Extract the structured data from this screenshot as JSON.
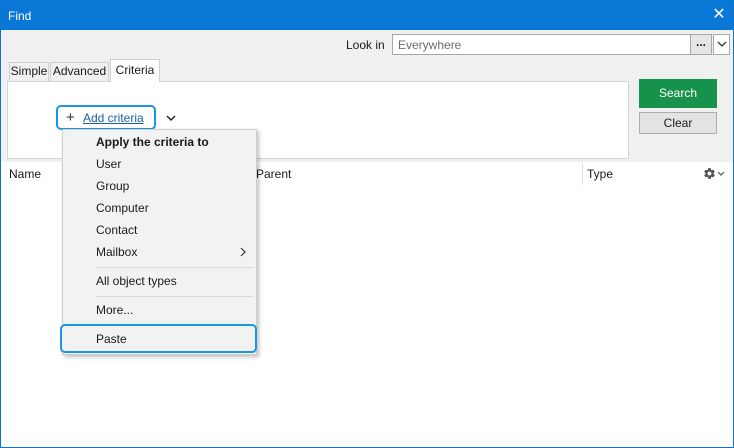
{
  "window": {
    "title": "Find"
  },
  "look_in": {
    "label": "Look in",
    "value": "Everywhere",
    "browse_label": "..."
  },
  "tabs": [
    {
      "label": "Simple",
      "active": false
    },
    {
      "label": "Advanced",
      "active": false
    },
    {
      "label": "Criteria",
      "active": true
    }
  ],
  "criteria": {
    "add_label": "Add criteria"
  },
  "buttons": {
    "search": "Search",
    "clear": "Clear"
  },
  "columns": [
    "Name",
    "Parent",
    "Type"
  ],
  "menu": {
    "header": "Apply the criteria to",
    "items": [
      "User",
      "Group",
      "Computer",
      "Contact",
      "Mailbox"
    ],
    "all_types": "All object types",
    "more": "More...",
    "paste": "Paste"
  },
  "colors": {
    "titlebar": "#0a78d7",
    "search_button": "#17924a",
    "highlight": "#1a96e6"
  }
}
